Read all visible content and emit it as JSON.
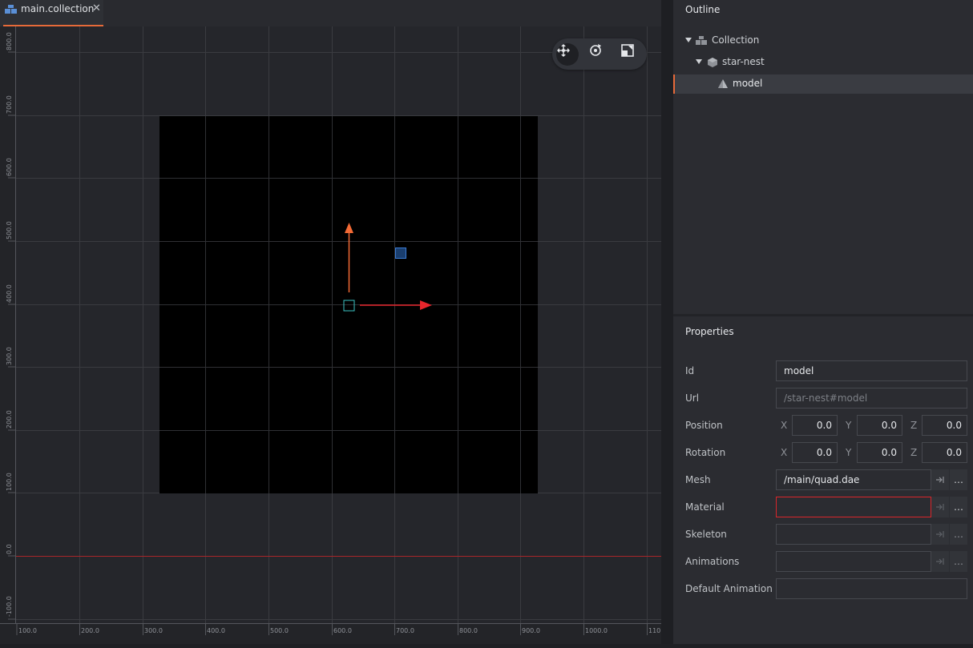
{
  "tab": {
    "title": "main.collection",
    "close": "✕"
  },
  "toolbar": {
    "tools": [
      {
        "name": "move-tool",
        "active": true
      },
      {
        "name": "rotate-tool",
        "active": false
      },
      {
        "name": "scale-tool",
        "active": false
      }
    ]
  },
  "ruler": {
    "y_labels": [
      "800.0",
      "700.0",
      "600.0",
      "500.0",
      "400.0",
      "300.0",
      "200.0",
      "100.0",
      "0.0",
      "-100.0"
    ],
    "x_labels": [
      "100.0",
      "200.0",
      "300.0",
      "400.0",
      "500.0",
      "600.0",
      "700.0",
      "800.0",
      "900.0",
      "1000.0",
      "110"
    ]
  },
  "outline": {
    "title": "Outline",
    "items": [
      {
        "label": "Collection",
        "icon": "collection-icon"
      },
      {
        "label": "star-nest",
        "icon": "game-object-icon"
      },
      {
        "label": "model",
        "icon": "model-icon",
        "selected": true
      }
    ]
  },
  "properties": {
    "title": "Properties",
    "id_label": "Id",
    "id_value": "model",
    "url_label": "Url",
    "url_value": "/star-nest#model",
    "position_label": "Position",
    "position": {
      "x": "0.0",
      "y": "0.0",
      "z": "0.0"
    },
    "rotation_label": "Rotation",
    "rotation": {
      "x": "0.0",
      "y": "0.0",
      "z": "0.0"
    },
    "axis_x": "X",
    "axis_y": "Y",
    "axis_z": "Z",
    "mesh_label": "Mesh",
    "mesh_value": "/main/quad.dae",
    "material_label": "Material",
    "material_value": "",
    "skeleton_label": "Skeleton",
    "skeleton_value": "",
    "animations_label": "Animations",
    "animations_value": "",
    "default_animation_label": "Default Animation",
    "default_animation_value": "",
    "browse_label": "…"
  },
  "colors": {
    "accent": "#e66a39",
    "error": "#d9262b",
    "x_axis": "#e8262c",
    "y_axis": "#f36a35",
    "selection_cyan": "#3bc4c4",
    "blue_handle": "#3a7bd5"
  }
}
